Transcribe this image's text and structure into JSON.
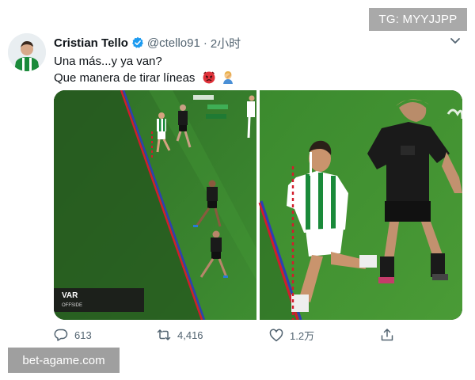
{
  "tweet": {
    "author_name": "Cristian Tello",
    "handle": "@ctello91",
    "separator": "·",
    "time": "2小时",
    "line1": "Una más...y ya van?",
    "line2": "Que manera de tirar líneas",
    "emojis": [
      "angry-face",
      "person-facepalming"
    ]
  },
  "media": {
    "var_label": "VAR",
    "offside_label": "OFFSIDE"
  },
  "actions": {
    "reply_count": "613",
    "retweet_count": "4,416",
    "like_count": "1.2万"
  },
  "watermarks": {
    "top_right": "TG: MYYJJPP",
    "bottom_left": "bet-agame.com"
  },
  "colors": {
    "verified": "#1d9bf0",
    "pitch_green": "#3f8a2f",
    "offside_line_red": "#d21c2c",
    "offside_line_blue": "#2d3fb3",
    "betis_green": "#1a8a3a",
    "opponent_dark": "#1a1a1a"
  }
}
